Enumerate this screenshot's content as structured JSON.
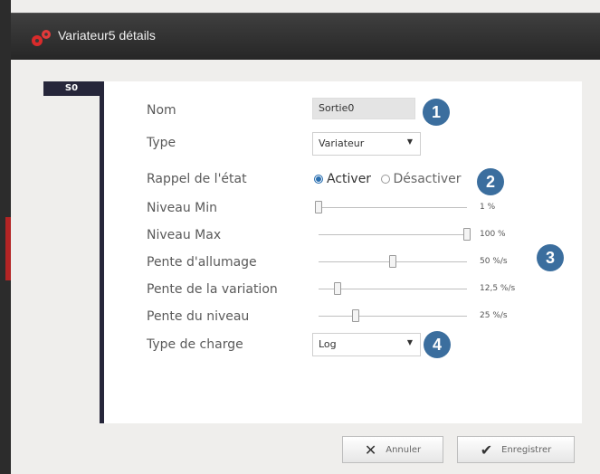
{
  "window": {
    "title": "Variateur5 détails"
  },
  "tab": {
    "label": "S0"
  },
  "form": {
    "name_label": "Nom",
    "name_value": "Sortie0",
    "type_label": "Type",
    "type_value": "Variateur",
    "recall_label": "Rappel de l'état",
    "recall_options": [
      "Activer",
      "Désactiver"
    ],
    "recall_selected": "Activer",
    "charge_type_label": "Type de charge",
    "charge_type_value": "Log"
  },
  "sliders": [
    {
      "label": "Niveau Min",
      "value_text": "1 %",
      "fraction": 0.0
    },
    {
      "label": "Niveau Max",
      "value_text": "100 %",
      "fraction": 1.0
    },
    {
      "label": "Pente d'allumage",
      "value_text": "50 %/s",
      "fraction": 0.5
    },
    {
      "label": "Pente de la variation",
      "value_text": "12,5 %/s",
      "fraction": 0.125
    },
    {
      "label": "Pente du niveau",
      "value_text": "25 %/s",
      "fraction": 0.25
    }
  ],
  "badges": [
    "1",
    "2",
    "3",
    "4"
  ],
  "buttons": {
    "cancel": "Annuler",
    "save": "Enregistrer"
  },
  "colors": {
    "badge": "#3b6e9e",
    "accent_red": "#cc2222",
    "panel_border": "#26263a"
  }
}
